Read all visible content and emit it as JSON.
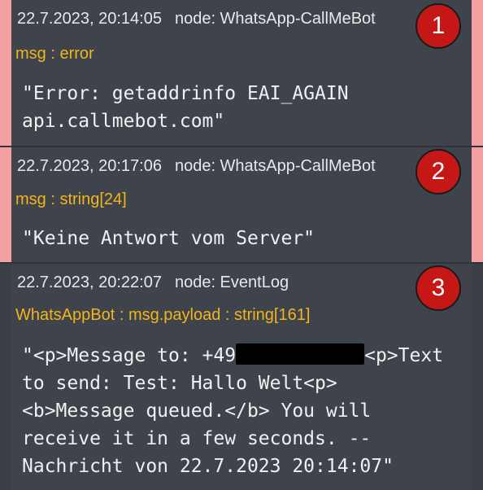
{
  "messages": [
    {
      "timestamp": "22.7.2023, 20:14:05",
      "node": "node: WhatsApp-CallMeBot",
      "topic": "msg : error",
      "payload_line1": "\"Error: getaddrinfo EAI_AGAIN",
      "payload_line2": "api.callmebot.com\"",
      "badge": "1"
    },
    {
      "timestamp": "22.7.2023, 20:17:06",
      "node": "node: WhatsApp-CallMeBot",
      "topic": "msg : string[24]",
      "payload_line1": "\"Keine Antwort vom Server\"",
      "badge": "2"
    },
    {
      "timestamp": "22.7.2023, 20:22:07",
      "node": "node: EventLog",
      "topic": "WhatsAppBot : msg.payload : string[161]",
      "payload_line1_pre": "\"<p>Message to: +49",
      "payload_line1_post": "<p>Text",
      "payload_line2": "to send: Test: Hallo Welt<p>",
      "payload_line3": "<b>Message queued.</b> You will",
      "payload_line4": "receive it in a few seconds. --",
      "payload_line5": "Nachricht von 22.7.2023 20:14:07\"",
      "badge": "3"
    }
  ],
  "colors": {
    "error_border": "#f4a0a0",
    "topic": "#f2b51a",
    "badge": "#c61717",
    "panel": "#3f434c"
  }
}
